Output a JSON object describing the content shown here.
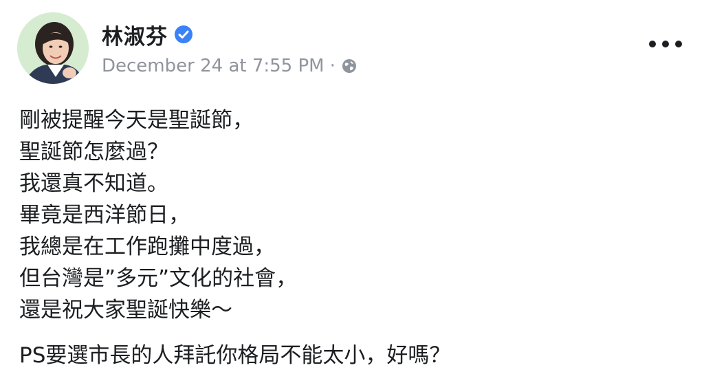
{
  "post": {
    "author": "林淑芬",
    "timestamp": "December 24 at 7:55 PM",
    "separator": "·",
    "privacy_icon": "globe-icon",
    "verified_icon": "verified-badge-icon",
    "verified_color": "#3b82f6",
    "more_icon": "more-options-icon",
    "lines": [
      "剛被提醒今天是聖誕節，",
      "聖誕節怎麼過？",
      "我還真不知道。",
      "畢竟是西洋節日，",
      "我總是在工作跑攤中度過，",
      "但台灣是”多元”文化的社會，",
      "還是祝大家聖誕快樂～"
    ],
    "ps": "PS要選市長的人拜託你格局不能太小，好嗎？"
  }
}
